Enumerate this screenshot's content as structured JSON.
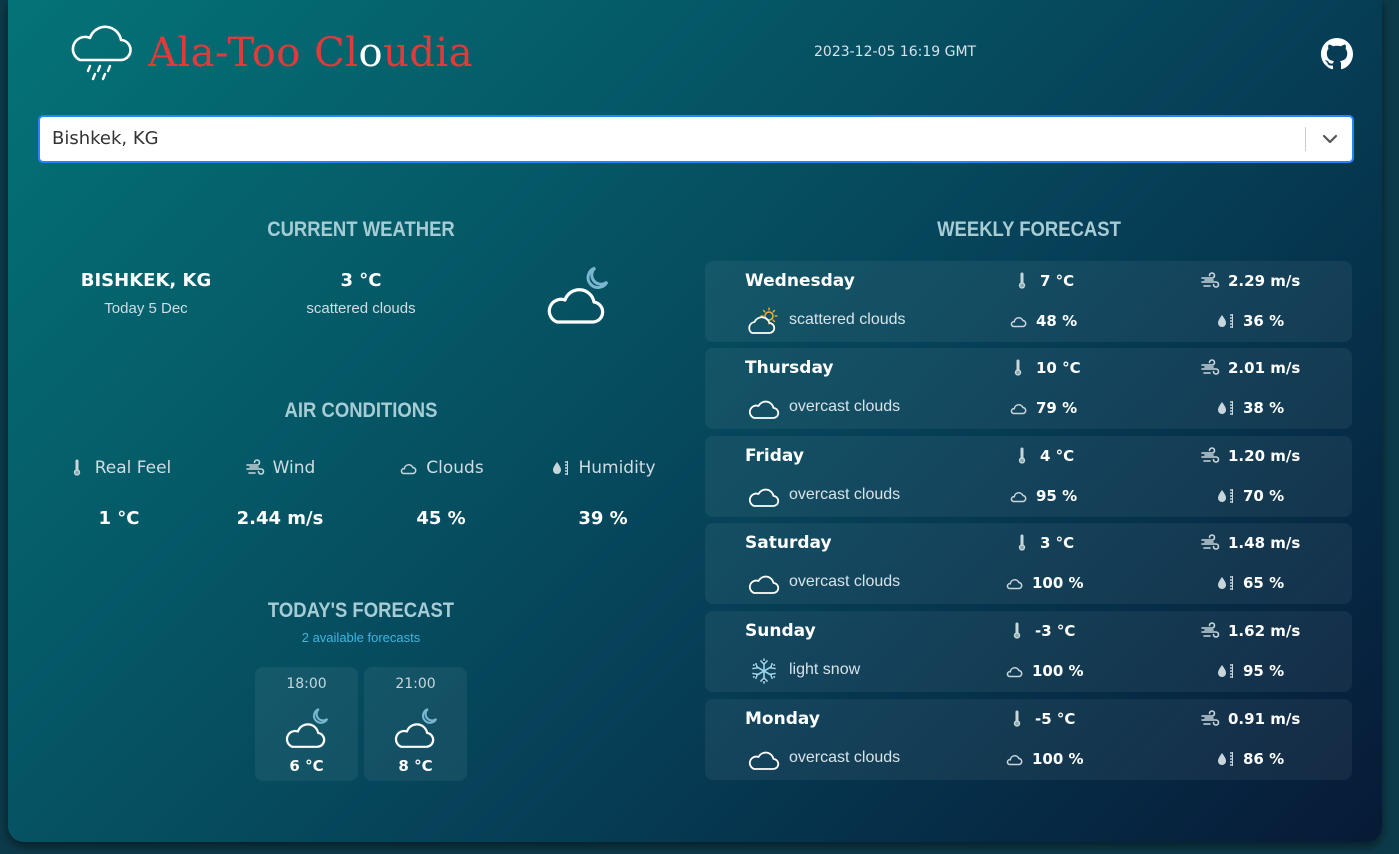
{
  "header": {
    "logo_text_part1": "Ala-Too Cl",
    "logo_text_o": "o",
    "logo_text_part2": "udia",
    "datetime": "2023-12-05 16:19 GMT",
    "github_icon": "github-icon"
  },
  "search": {
    "value": "Bishkek, KG",
    "dropdown_icon": "chevron-down-icon"
  },
  "current_weather": {
    "title": "CURRENT WEATHER",
    "city": "BISHKEK, KG",
    "date": "Today 5 Dec",
    "temperature": "3 °C",
    "description": "scattered clouds",
    "icon": "moon-cloud-icon"
  },
  "air_conditions": {
    "title": "AIR CONDITIONS",
    "items": [
      {
        "label": "Real Feel",
        "value": "1 °C",
        "icon": "thermometer-icon"
      },
      {
        "label": "Wind",
        "value": "2.44 m/s",
        "icon": "wind-icon"
      },
      {
        "label": "Clouds",
        "value": "45 %",
        "icon": "cloud-icon"
      },
      {
        "label": "Humidity",
        "value": "39 %",
        "icon": "humidity-icon"
      }
    ]
  },
  "todays_forecast": {
    "title": "TODAY'S FORECAST",
    "subtitle": "2 available forecasts",
    "items": [
      {
        "time": "18:00",
        "temperature": "6 °C",
        "icon": "moon-cloud-icon"
      },
      {
        "time": "21:00",
        "temperature": "8 °C",
        "icon": "moon-cloud-icon"
      }
    ]
  },
  "weekly_forecast": {
    "title": "WEEKLY FORECAST",
    "days": [
      {
        "day": "Wednesday",
        "description": "scattered clouds",
        "icon": "sun-cloud-icon",
        "temperature": "7 °C",
        "wind": "2.29 m/s",
        "clouds": "48 %",
        "humidity": "36 %"
      },
      {
        "day": "Thursday",
        "description": "overcast clouds",
        "icon": "cloud-icon",
        "temperature": "10 °C",
        "wind": "2.01 m/s",
        "clouds": "79 %",
        "humidity": "38 %"
      },
      {
        "day": "Friday",
        "description": "overcast clouds",
        "icon": "cloud-icon",
        "temperature": "4 °C",
        "wind": "1.20 m/s",
        "clouds": "95 %",
        "humidity": "70 %"
      },
      {
        "day": "Saturday",
        "description": "overcast clouds",
        "icon": "cloud-icon",
        "temperature": "3 °C",
        "wind": "1.48 m/s",
        "clouds": "100 %",
        "humidity": "65 %"
      },
      {
        "day": "Sunday",
        "description": "light snow",
        "icon": "snowflake-icon",
        "temperature": "-3 °C",
        "wind": "1.62 m/s",
        "clouds": "100 %",
        "humidity": "95 %"
      },
      {
        "day": "Monday",
        "description": "overcast clouds",
        "icon": "cloud-icon",
        "temperature": "-5 °C",
        "wind": "0.91 m/s",
        "clouds": "100 %",
        "humidity": "86 %"
      }
    ]
  }
}
